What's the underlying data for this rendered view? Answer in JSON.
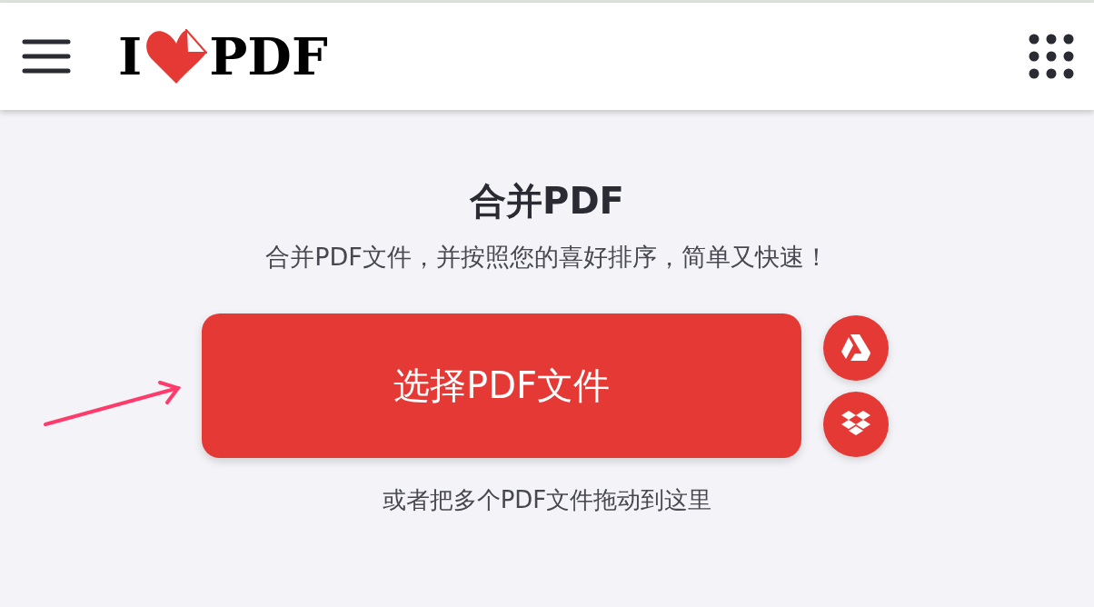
{
  "header": {
    "logo": {
      "left": "I",
      "right": "PDF"
    }
  },
  "title": "合并PDF",
  "subtitle": "合并PDF文件，并按照您的喜好排序，简单又快速！",
  "select_button": "选择PDF文件",
  "drop_hint": "或者把多个PDF文件拖动到这里"
}
